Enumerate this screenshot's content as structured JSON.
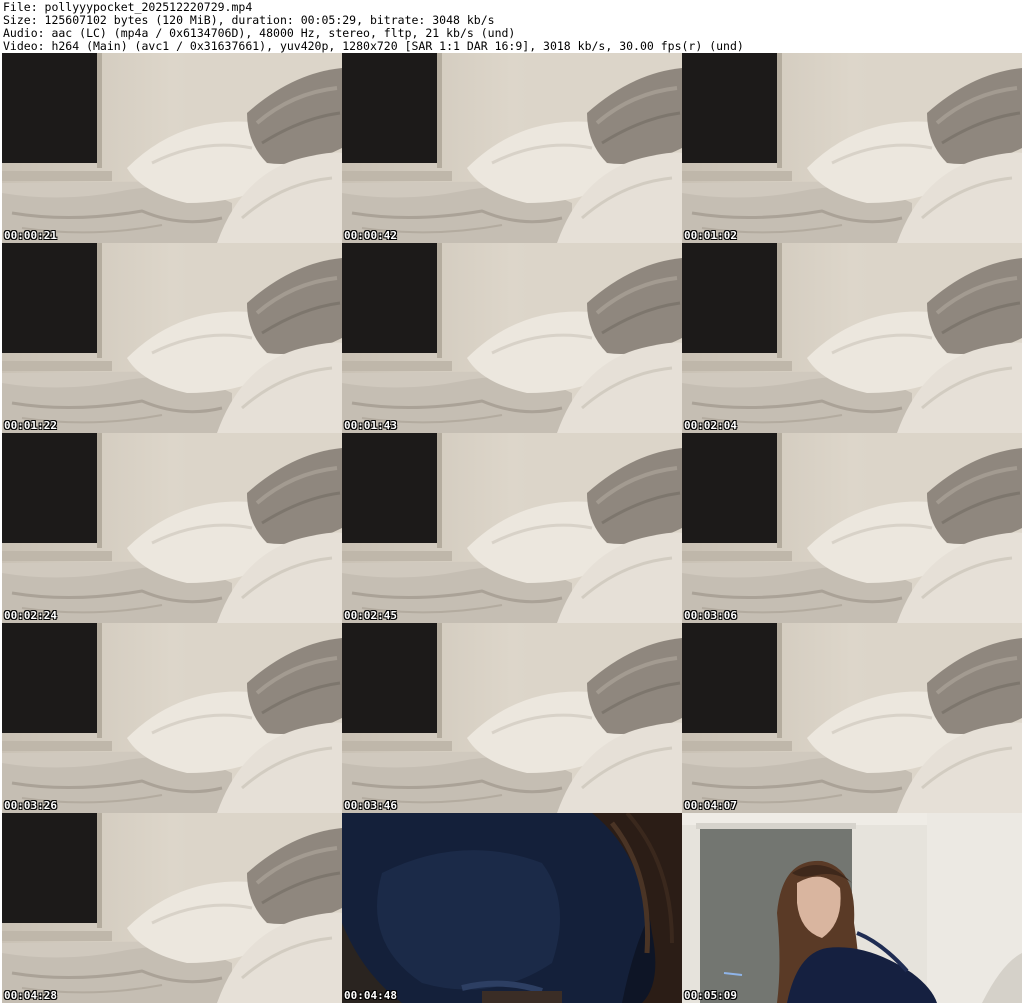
{
  "header": {
    "line1": "File: pollyyypocket_202512220729.mp4",
    "line2": "Size: 125607102 bytes (120 MiB), duration: 00:05:29, bitrate: 3048 kb/s",
    "line3": "Audio: aac (LC) (mp4a / 0x6134706D), 48000 Hz, stereo, fltp, 21 kb/s (und)",
    "line4": "Video: h264 (Main) (avc1 / 0x31637661), yuv420p, 1280x720 [SAR 1:1 DAR 16:9], 3018 kb/s, 30.00 fps(r) (und)"
  },
  "thumbnails": [
    {
      "timestamp": "00:00:21",
      "scene": "bed"
    },
    {
      "timestamp": "00:00:42",
      "scene": "bed"
    },
    {
      "timestamp": "00:01:02",
      "scene": "bed"
    },
    {
      "timestamp": "00:01:22",
      "scene": "bed"
    },
    {
      "timestamp": "00:01:43",
      "scene": "bed"
    },
    {
      "timestamp": "00:02:04",
      "scene": "bed"
    },
    {
      "timestamp": "00:02:24",
      "scene": "bed"
    },
    {
      "timestamp": "00:02:45",
      "scene": "bed"
    },
    {
      "timestamp": "00:03:06",
      "scene": "bed"
    },
    {
      "timestamp": "00:03:26",
      "scene": "bed"
    },
    {
      "timestamp": "00:03:46",
      "scene": "bed"
    },
    {
      "timestamp": "00:04:07",
      "scene": "bed"
    },
    {
      "timestamp": "00:04:28",
      "scene": "bed"
    },
    {
      "timestamp": "00:04:48",
      "scene": "dark-closeup"
    },
    {
      "timestamp": "00:05:09",
      "scene": "person"
    }
  ],
  "colors": {
    "wall": "#d8d1c5",
    "dark_panel": "#1c1a19",
    "pillow": "#ece7de",
    "throw": "#8f877e",
    "duvet": "#e3ddd4",
    "navy": "#14203a",
    "ts_text": "#ffffff"
  }
}
